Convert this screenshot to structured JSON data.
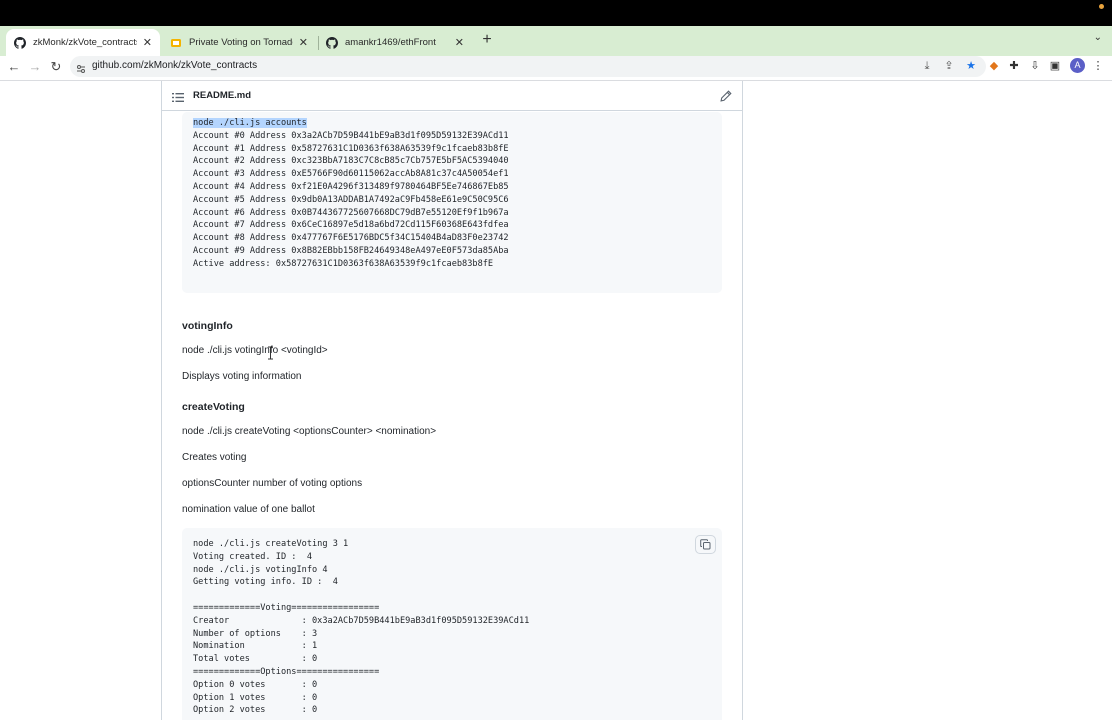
{
  "browser": {
    "tabs": [
      {
        "label": "zkMonk/zkVote_contracts",
        "icon": "github-icon",
        "active": true
      },
      {
        "label": "Private Voting on Tornado Ca",
        "icon": "slides-icon",
        "active": false
      },
      {
        "label": "amankr1469/ethFront",
        "icon": "github-icon",
        "active": false
      }
    ],
    "new_tab": "+",
    "url": "github.com/zkMonk/zkVote_contracts",
    "avatar_letter": "A"
  },
  "readme": {
    "filename": "README.md",
    "accounts_block": [
      "node ./cli.js accounts",
      "Account #0 Address 0x3a2ACb7D59B441bE9aB3d1f095D59132E39ACd11",
      "Account #1 Address 0x58727631C1D0363f638A63539f9c1fcaeb83b8fE",
      "Account #2 Address 0xc323BbA7183C7C8cB85c7Cb757E5bF5AC5394040",
      "Account #3 Address 0xE5766F90d60115062accAb8A81c37c4A50054ef1",
      "Account #4 Address 0xf21E0A4296f313489f9780464BF5Ee746867Eb85",
      "Account #5 Address 0x9db0A13ADDAB1A7492aC9Fb458eE61e9C50C95C6",
      "Account #6 Address 0x0B744367725607668DC79dB7e55120Ef9f1b967a",
      "Account #7 Address 0x6CeC16897e5d18a6bd72Cd115F60368E643fdfea",
      "Account #8 Address 0x477767F6E5176BDC5f34C15404B4aD83F0e23742",
      "Account #9 Address 0x8B82EBbb158FB24649348eA497eE0F573da85Aba",
      "Active address: 0x58727631C1D0363f638A63539f9c1fcaeb83b8fE"
    ],
    "voting_info": {
      "heading": "votingInfo",
      "command": "node ./cli.js votingInfo <votingId>",
      "description": "Displays voting information"
    },
    "create_voting": {
      "heading": "createVoting",
      "command": "node ./cli.js createVoting <optionsCounter> <nomination>",
      "description": "Creates voting",
      "param1": "optionsCounter number of voting options",
      "param2": "nomination value of one ballot"
    },
    "create_block": [
      "node ./cli.js createVoting 3 1",
      "Voting created. ID :  4",
      "node ./cli.js votingInfo 4",
      "Getting voting info. ID :  4",
      "",
      "=============Voting=================",
      "Creator              : 0x3a2ACb7D59B441bE9aB3d1f095D59132E39ACd11",
      "Number of options    : 3",
      "Nomination           : 1",
      "Total votes          : 0",
      "=============Options================",
      "Option 0 votes       : 0",
      "Option 1 votes       : 0",
      "Option 2 votes       : 0"
    ]
  },
  "colors": {
    "tab_strip": "#d8edd2",
    "selection": "#b4d5fe",
    "code_bg": "#f6f8fa",
    "border": "#d0d7de"
  }
}
